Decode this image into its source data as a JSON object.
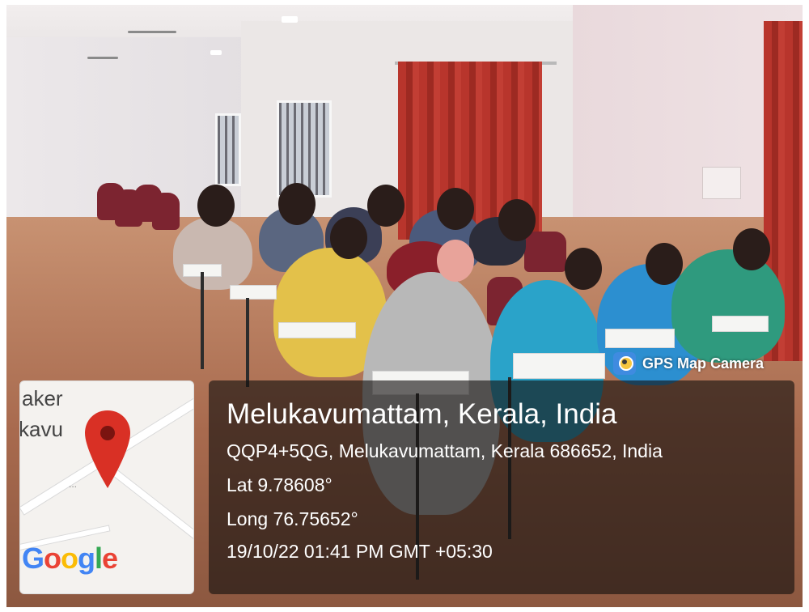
{
  "photo": {
    "description_icon": "classroom-exam-photo"
  },
  "map": {
    "place_label_top": "aker",
    "place_label_bottom": "kavu",
    "dots": "...",
    "google_logo": "Google",
    "pin_color": "#d93025"
  },
  "badge": {
    "icon": "gps-map-camera-icon",
    "label": "GPS Map Camera"
  },
  "location": {
    "title": "Melukavumattam, Kerala, India",
    "address": "QQP4+5QG, Melukavumattam, Kerala 686652, India",
    "lat": "Lat 9.78608°",
    "long": "Long 76.75652°",
    "timestamp": "19/10/22 01:41 PM GMT +05:30"
  },
  "colors": {
    "overlay": "#14100e",
    "google_blue": "#4285f4",
    "google_red": "#ea4335",
    "google_yellow": "#fbbc05",
    "google_green": "#34a853"
  }
}
